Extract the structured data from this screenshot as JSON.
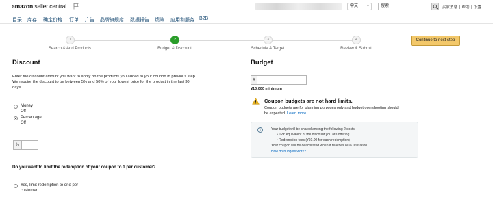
{
  "header": {
    "logo_prefix": "amazon",
    "logo_suffix": "seller central",
    "language": "中文",
    "search_placeholder": "搜索",
    "links": [
      "买家消息",
      "帮助",
      "设置"
    ],
    "link_separator": "|"
  },
  "nav": {
    "items": [
      "目录",
      "库存",
      "确定价格",
      "订单",
      "广告",
      "品牌旗舰店",
      "数据报告",
      "绩效",
      "应用和服务",
      "B2B"
    ]
  },
  "stepper": {
    "steps": [
      {
        "number": "1",
        "label": "Search & Add Products",
        "active": false
      },
      {
        "number": "2",
        "label": "Budget & Discount",
        "active": true
      },
      {
        "number": "3",
        "label": "Schedule & Target",
        "active": false
      },
      {
        "number": "4",
        "label": "Review & Submit",
        "active": false
      }
    ],
    "continue_label": "Continue to next step",
    "active_color": "#2a9d2a"
  },
  "discount": {
    "title": "Discount",
    "description": "Enter the discount amount you want to apply on the products you added to your coupon in previous step. We require the discount to be between 5% and 50% of your lowest price for the product in the last 30 days.",
    "options": [
      {
        "label": "Money",
        "sub": "Off",
        "checked": false
      },
      {
        "label": "Percentage",
        "sub": "Off",
        "checked": true
      }
    ],
    "percent_prefix": "%",
    "percent_value": "",
    "limit_question": "Do you want to limit the redemption of your coupon to 1 per customer?",
    "limit_options": [
      {
        "label": "Yes, limit redemption to one per",
        "sub": "customer",
        "checked": false
      }
    ]
  },
  "budget": {
    "title": "Budget",
    "currency_prefix": "¥",
    "value": "",
    "minimum": "¥10,000 minimum",
    "warning_title": "Coupon budgets are not hard limits.",
    "warning_text": "Coupon budgets are for planning purposes only and budget overshooting should be expected.",
    "warning_link": "Learn more",
    "warning_color": "#e8b321",
    "info": {
      "intro": "Your budget will be shared among the following 2 costs:",
      "bullets": [
        "JPY equivalent of the discount you are offering",
        "Redemption fees (¥60.00 for each redemption)"
      ],
      "deactivate": "Your coupon will be deactivated when it reaches 80% utilization.",
      "link": "How do budgets work?"
    }
  }
}
